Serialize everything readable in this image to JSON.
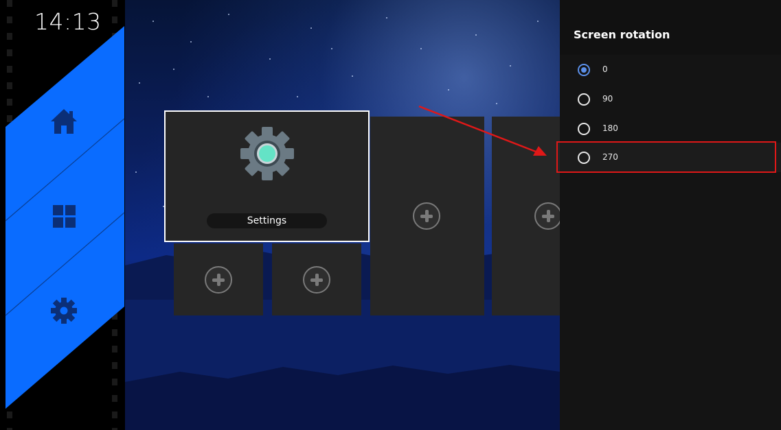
{
  "status": {
    "time": "14:13"
  },
  "sidebar": {
    "items": [
      {
        "name": "home",
        "icon": "home-icon"
      },
      {
        "name": "apps",
        "icon": "apps-grid-icon"
      },
      {
        "name": "settings",
        "icon": "gear-icon"
      }
    ],
    "color": "#0a6cff"
  },
  "launcher": {
    "selected_tile": {
      "label": "Settings",
      "icon": "settings-gear-icon"
    }
  },
  "panel": {
    "title": "Screen rotation",
    "options": [
      {
        "label": "0",
        "checked": true
      },
      {
        "label": "90",
        "checked": false
      },
      {
        "label": "180",
        "checked": false
      },
      {
        "label": "270",
        "checked": false
      }
    ],
    "accent": "#5b8fe8"
  },
  "annotation": {
    "color": "#e01818"
  }
}
